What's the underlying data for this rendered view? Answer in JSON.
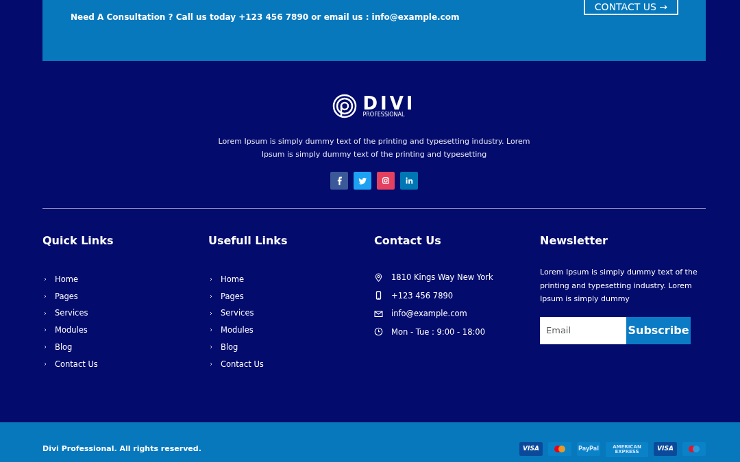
{
  "banner": {
    "text": "Need A Consultation ? Call us today +123 456 7890 or email us : info@example.com",
    "button": {
      "label": "CONTACT US",
      "arrow": "→"
    }
  },
  "brand": {
    "name": "DIVI",
    "tagline": "PROFESSIONAL",
    "description": "Lorem Ipsum is simply dummy text of the printing and typesetting industry. Lorem Ipsum is simply dummy text of the printing and typesetting"
  },
  "social": [
    {
      "kind": "facebook",
      "color": "#3b5998"
    },
    {
      "kind": "twitter",
      "color": "#1da1f2"
    },
    {
      "kind": "instagram",
      "color": "#e4405f"
    },
    {
      "kind": "linkedin",
      "color": "#0077b5"
    }
  ],
  "columns": [
    {
      "title": "Quick Links",
      "kind": "links",
      "items": [
        "Home",
        "Pages",
        "Services",
        "Modules",
        "Blog",
        "Contact Us"
      ]
    },
    {
      "title": "Usefull Links",
      "kind": "links",
      "items": [
        "Home",
        "Pages",
        "Services",
        "Modules",
        "Blog",
        "Contact Us"
      ]
    },
    {
      "title": "Contact Us",
      "kind": "contact",
      "items": [
        {
          "kind": "address",
          "text": "1810 Kings Way New York"
        },
        {
          "kind": "phone",
          "text": "+123 456 7890"
        },
        {
          "kind": "email",
          "text": "info@example.com"
        },
        {
          "kind": "hours",
          "text": "Mon - Tue : 9:00 - 18:00"
        }
      ]
    },
    {
      "title": "Newsletter",
      "kind": "newsletter",
      "text": "Lorem Ipsum is simply dummy text of the printing and typesetting industry. Lorem Ipsum is simply dummy",
      "placeholder": "Email",
      "button": "Subscribe"
    }
  ],
  "bottom_bar": {
    "copyright": "Divi Professional. All rights reserved.",
    "payments": [
      {
        "kind": "visa",
        "label": "VISA"
      },
      {
        "kind": "mastercard"
      },
      {
        "kind": "paypal",
        "label": "PayPal"
      },
      {
        "kind": "amex",
        "label": "AMERICAN EXPRESS"
      },
      {
        "kind": "visa",
        "label": "VISA"
      },
      {
        "kind": "maestro"
      }
    ]
  }
}
